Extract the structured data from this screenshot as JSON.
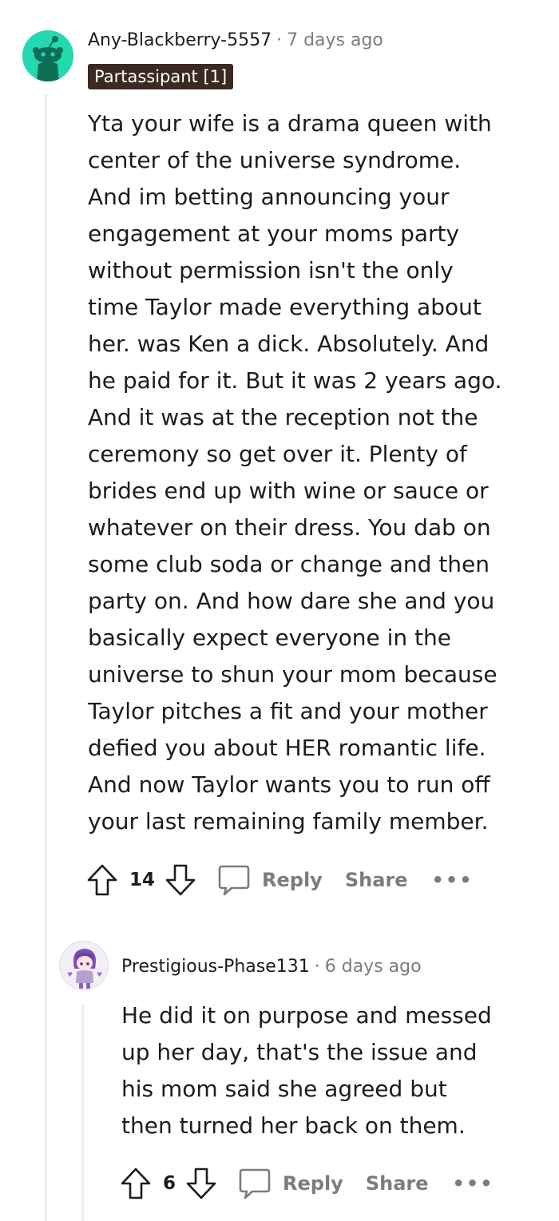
{
  "comments": [
    {
      "author": "Any-Blackberry-5557",
      "separator": "·",
      "time": "7 days ago",
      "flair": "Partassipant [1]",
      "avatar": "reddit-snoo-avatar",
      "avatar_color": "#24d8b0",
      "body": "Yta your wife is a drama queen with\ncenter of the universe syndrome.\nAnd im betting announcing your\nengagement at your moms party\nwithout permission isn't the only\ntime Taylor made everything about\nher. was Ken a dick. Absolutely. And\nhe paid for it. But it was 2 years ago.\nAnd it was at the reception not the\nceremony so get over it. Plenty of\nbrides end up with wine or sauce or\nwhatever on their dress. You dab on\nsome club soda or change and then\nparty on. And how dare she and you\nbasically expect everyone in the\nuniverse to shun your mom because\nTaylor pitches a fit and your mother\ndefied you about HER romantic life.\nAnd now Taylor wants you to run off\nyour last remaining family member.",
      "score": "14",
      "reply_label": "Reply",
      "share_label": "Share",
      "more_label": "•••"
    },
    {
      "author": "Prestigious-Phase131",
      "separator": "·",
      "time": "6 days ago",
      "avatar": "anime-character-avatar",
      "avatar_color": "#b79fd0",
      "body": "He did it on purpose and messed\nup her day, that's the issue and\nhis mom said she agreed but\nthen turned her back on them.",
      "score": "6",
      "reply_label": "Reply",
      "share_label": "Share",
      "more_label": "•••"
    }
  ],
  "colors": {
    "text": "#1c1c1c",
    "meta": "#7c7c7c",
    "flair_bg": "#3b2a22",
    "thread_line": "#ececec"
  }
}
